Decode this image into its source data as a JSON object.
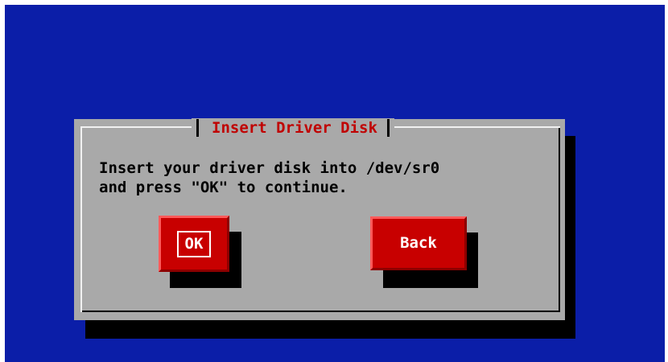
{
  "dialog": {
    "title": "Insert Driver Disk",
    "message_lines": [
      "Insert your driver disk into /dev/sr0",
      "and press \"OK\" to continue."
    ],
    "buttons": {
      "ok": "OK",
      "back": "Back"
    }
  },
  "colors": {
    "screen_background": "#0b1ea8",
    "dialog_background": "#a9a9a9",
    "title_text": "#c00000",
    "button_background": "#c80000",
    "button_text": "#ffffff",
    "shadow": "#000000"
  }
}
